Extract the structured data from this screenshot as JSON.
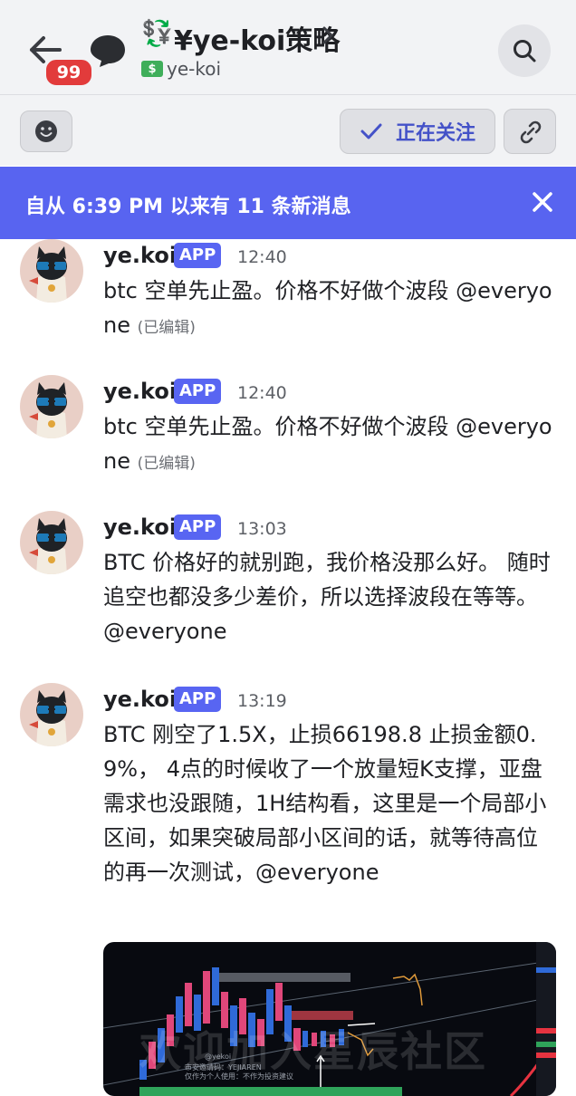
{
  "header": {
    "badge_count": "99",
    "channel_emoji": "💱",
    "channel_title": "¥ye-koi策略",
    "channel_sub": "ye-koi"
  },
  "action_bar": {
    "follow_label": "正在关注"
  },
  "banner": {
    "text": "自从 6:39 PM 以来有 11 条新消息"
  },
  "messages": [
    {
      "author": "ye.koi",
      "tag": "APP",
      "time": "12:40",
      "text": "btc 空单先止盈。价格不好做个波段 @everyone",
      "edited": "(已编辑)"
    },
    {
      "author": "ye.koi",
      "tag": "APP",
      "time": "12:40",
      "text": "btc 空单先止盈。价格不好做个波段 @everyone",
      "edited": "(已编辑)"
    },
    {
      "author": "ye.koi",
      "tag": "APP",
      "time": "13:03",
      "text": "BTC 价格好的就别跑，我价格没那么好。 随时追空也都没多少差价，所以选择波段在等等。@everyone"
    },
    {
      "author": "ye.koi",
      "tag": "APP",
      "time": "13:19",
      "text": "BTC 刚空了1.5X，止损66198.8 止损金额0.9%， 4点的时候收了一个放量短K支撑，亚盘需求也没跟随，1H结构看，这里是一个局部小区间，如果突破局部小区间的话，就等待高位的再一次测试，@everyone",
      "image": {
        "watermark": "欢迎加入星辰社区",
        "handle": "@yekoi",
        "note1": "市安邀请码：YEJIAREN",
        "note2": "仅作为个人使用：不作为投资建议"
      }
    }
  ]
}
